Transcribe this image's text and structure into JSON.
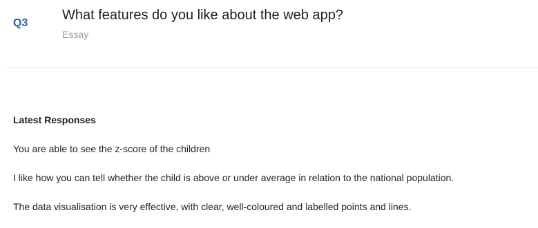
{
  "question": {
    "number": "Q3",
    "title": "What features do you like about the web app?",
    "type": "Essay"
  },
  "responses": {
    "heading": "Latest Responses",
    "items": [
      "You are able to see the z-score of the children",
      "I like how you can tell whether the child is above or under average in relation to the national population.",
      "The data visualisation is very effective, with clear, well-coloured and labelled points and lines."
    ]
  }
}
